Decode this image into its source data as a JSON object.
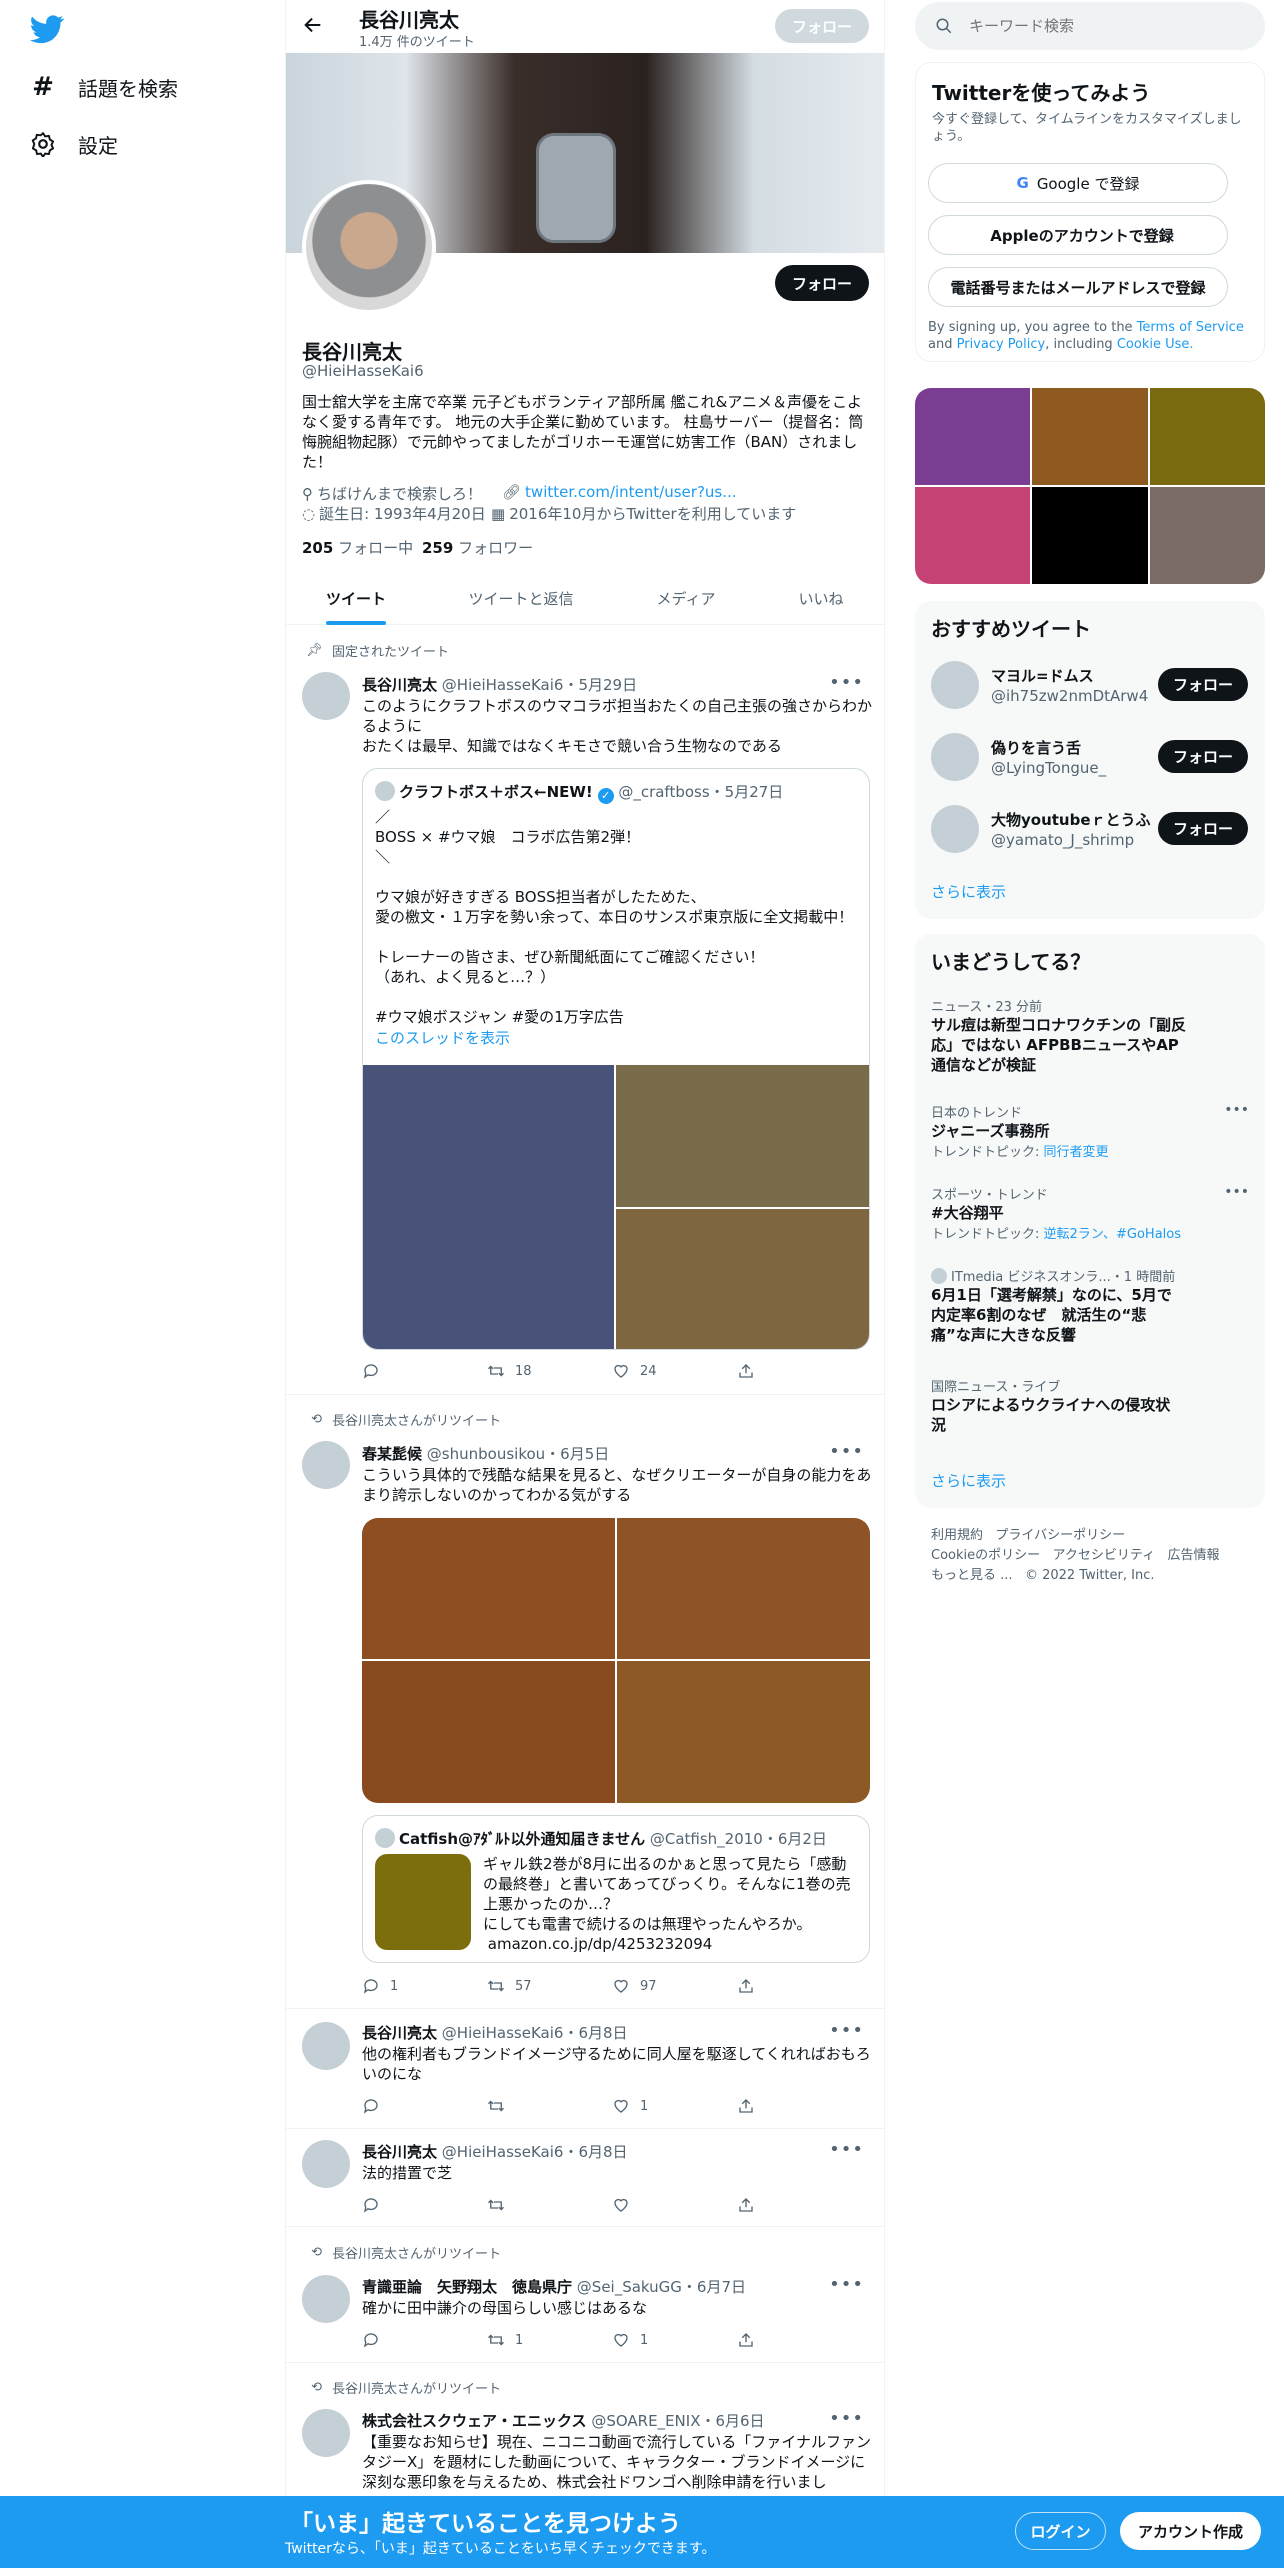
{
  "nav": {
    "explore_label": "話題を検索",
    "settings_label": "設定"
  },
  "profile": {
    "name": "長谷川亮太",
    "tweet_count": "1.4万 件のツイート",
    "handle": "@HieiHasseKai6",
    "bio": "国士舘大学を主席で卒業 元子どもボランティア部所属 艦これ&アニメ＆声優をこよなく愛する青年です。 地元の大手企業に勤めています。 柱島サーバー（提督名：筒悔腕組物起豚）で元帥やってましたがゴリホーモ運営に妨害工作（BAN）されました！",
    "location": "ちばけんまで検索しろ！",
    "link": "twitter.com/intent/user?us...",
    "birthday": "誕生日: 1993年4月20日",
    "joined": "2016年10月からTwitterを利用しています",
    "following_count": "205",
    "following_label": "フォロー中",
    "followers_count": "259",
    "followers_label": "フォロワー",
    "follow_label": "フォロー"
  },
  "tabs": [
    "ツイート",
    "ツイートと返信",
    "メディア",
    "いいね"
  ],
  "pinned_label": "固定されたツイート",
  "retweeted_label": "長谷川亮太さんがリツイート",
  "tweets": [
    {
      "name": "長谷川亮太",
      "meta": "@HieiHasseKai6・5月29日",
      "text": "このようにクラフトボスのウマコラボ担当おたくの自己主張の強さからわかるように\nおたくは最早、知識ではなくキモさで競い合う生物なのである",
      "quote": {
        "name": "クラフトボス＋ボス←NEW!",
        "meta": "@_craftboss・5月27日",
        "text": "／\nBOSS × #ウマ娘　コラボ広告第2弾！\n＼\n\nウマ娘が好きすぎる BOSS担当者がしたためた、\n愛の檄文・１万字を勢い余って、本日のサンスポ東京版に全文掲載中！\n\nトレーナーの皆さま、ぜひ新聞紙面にてご確認ください！\n（あれ、よく見ると…？）\n\n#ウマ娘ボスジャン #愛の1万字広告",
        "thread_link": "このスレッドを表示"
      },
      "reply": "",
      "retweets": "18",
      "likes": "24"
    },
    {
      "name": "春某髭候",
      "meta": "@shunbousikou・6月5日",
      "text": "こういう具体的で残酷な結果を見ると、なぜクリエーターが自身の能力をあまり誇示しないのかってわかる気がする",
      "quote": {
        "name": "Catfish@ｱﾀﾞﾙﾄ以外通知届きません",
        "meta": "@Catfish_2010・6月2日",
        "text": "ギャル鉄2巻が8月に出るのかぁと思って見たら「感動の最終巻」と書いてあってびっくり。そんなに1巻の売上悪かったのか…？\nにしても電書で続けるのは無理やったんやろか。\n amazon.co.jp/dp/4253232094"
      },
      "reply": "1",
      "retweets": "57",
      "likes": "97"
    },
    {
      "name": "長谷川亮太",
      "meta": "@HieiHasseKai6・6月8日",
      "text": "他の権利者もブランドイメージ守るために同人屋を駆逐してくれればおもろいのにな",
      "reply": "",
      "retweets": "",
      "likes": "1"
    },
    {
      "name": "長谷川亮太",
      "meta": "@HieiHasseKai6・6月8日",
      "text": "法的措置で芝",
      "reply": "",
      "retweets": "",
      "likes": ""
    },
    {
      "name": "青識亜論　矢野翔太　徳島県庁",
      "meta": "@Sei_SakuGG・6月7日",
      "text": "確かに田中謙介の母国らしい感じはあるな",
      "reply": "",
      "retweets": "1",
      "likes": "1"
    },
    {
      "name": "株式会社スクウェア・エニックス",
      "meta": "@SOARE_ENIX・6月6日",
      "text": "【重要なお知らせ】現在、ニコニコ動画で流行している「ファイナルファンタジーX」を題材にした動画について、キャラクター・ブランドイメージに深刻な悪印象を与えるため、株式会社ドワンゴへ削除申請を行いまし"
    }
  ],
  "search": {
    "placeholder": "キーワード検索"
  },
  "signup": {
    "title": "Twitterを使ってみよう",
    "subtitle": "今すぐ登録して、タイムラインをカスタマイズしましょう。",
    "google": "Google で登録",
    "apple": "Appleのアカウントで登録",
    "phone": "電話番号またはメールアドレスで登録",
    "legal_1": "By signing up, you agree to the",
    "legal_terms": "Terms of Service",
    "legal_and": "and",
    "legal_privacy": "Privacy Policy",
    "legal_incl": ", including",
    "legal_cookie": "Cookie Use."
  },
  "media_grid_colors": [
    "#7a3d91",
    "#8f5a1f",
    "#7a6a0f",
    "#c44374",
    "#000000",
    "#7a6c65"
  ],
  "recommended": {
    "title": "おすすめツイート",
    "users": [
      {
        "name": "マヨル=ドムス",
        "handle": "@ih75zw2nmDtArw4"
      },
      {
        "name": "偽りを言う舌",
        "handle": "@LyingTongue_"
      },
      {
        "name": "大物youtubeｒとうふ",
        "handle": "@yamato_J_shrimp"
      }
    ],
    "more": "さらに表示"
  },
  "trends": {
    "title": "いまどうしてる？",
    "items": [
      {
        "cat": "ニュース・23 分前",
        "title": "サル痘は新型コロナワクチンの「副反応」ではない AFPBBニュースやAP通信などが検証",
        "sub": ""
      },
      {
        "cat": "日本のトレンド",
        "title": "ジャニーズ事務所",
        "sub_prefix": "トレンドトピック: ",
        "sub": "同行者変更"
      },
      {
        "cat": "スポーツ・トレンド",
        "title": "#大谷翔平",
        "sub_prefix": "トレンドトピック: ",
        "sub": "逆転2ラン、#GoHalos"
      },
      {
        "cat": "ITmedia ビジネスオンラ...・1 時間前",
        "title": "6月1日「選考解禁」なのに、5月で内定率6割のなぜ　就活生の“悲痛”な声に大きな反響",
        "sub": ""
      },
      {
        "cat": "国際ニュース・ライブ",
        "title": "ロシアによるウクライナへの侵攻状況",
        "sub": ""
      }
    ],
    "more": "さらに表示"
  },
  "footer": {
    "terms": "利用規約",
    "privacy": "プライバシーポリシー",
    "cookie": "Cookieのポリシー",
    "access": "アクセシビリティ",
    "ads": "広告情報",
    "more": "もっと見る ...",
    "copyright": "© 2022 Twitter, Inc."
  },
  "bottom": {
    "title": "「いま」起きていることを見つけよう",
    "subtitle": "Twitterなら、「いま」起きていることをいち早くチェックできます。",
    "login": "ログイン",
    "signup": "アカウント作成"
  }
}
